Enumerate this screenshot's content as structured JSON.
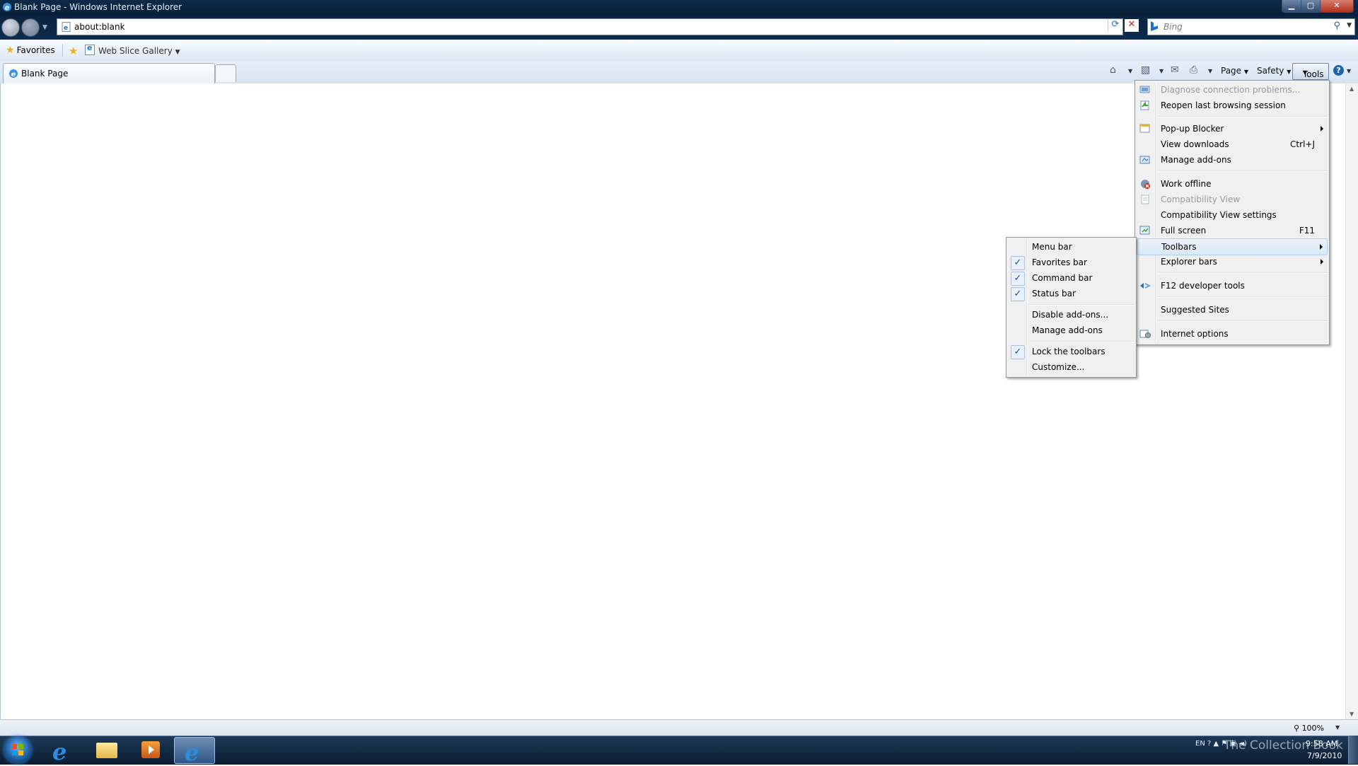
{
  "window": {
    "title": "Blank Page - Windows Internet Explorer",
    "min_label": "▁",
    "max_label": "▢",
    "close_label": "✕"
  },
  "address": {
    "url": "about:blank"
  },
  "search": {
    "placeholder": "Bing"
  },
  "favorites_bar": {
    "favorites_label": "Favorites",
    "web_slice_label": "Web Slice Gallery"
  },
  "tabs": [
    {
      "label": "Blank Page"
    }
  ],
  "command_bar": {
    "page_label": "Page",
    "safety_label": "Safety",
    "tools_label": "Tools",
    "help_label": "?"
  },
  "tools_menu": {
    "items": [
      {
        "label": "Diagnose connection problems...",
        "disabled": true
      },
      {
        "label": "Reopen last browsing session"
      },
      {
        "label": "Pop-up Blocker",
        "submenu": true
      },
      {
        "label": "View downloads",
        "shortcut": "Ctrl+J"
      },
      {
        "label": "Manage add-ons"
      },
      {
        "label": "Work offline"
      },
      {
        "label": "Compatibility View",
        "disabled": true
      },
      {
        "label": "Compatibility View settings"
      },
      {
        "label": "Full screen",
        "shortcut": "F11"
      },
      {
        "label": "Toolbars",
        "submenu": true,
        "highlighted": true
      },
      {
        "label": "Explorer bars",
        "submenu": true
      },
      {
        "label": "F12 developer tools"
      },
      {
        "label": "Suggested Sites"
      },
      {
        "label": "Internet options"
      }
    ]
  },
  "toolbars_submenu": {
    "items": [
      {
        "label": "Menu bar",
        "checked": false
      },
      {
        "label": "Favorites bar",
        "checked": true
      },
      {
        "label": "Command bar",
        "checked": true
      },
      {
        "label": "Status bar",
        "checked": true
      },
      {
        "label": "Disable add-ons...",
        "checked": false
      },
      {
        "label": "Manage add-ons",
        "checked": false
      },
      {
        "label": "Lock the toolbars",
        "checked": true
      },
      {
        "label": "Customize...",
        "checked": false
      }
    ]
  },
  "status_bar": {
    "zoom": "100%"
  },
  "taskbar": {
    "tray": "EN",
    "time": "9:58 AM",
    "date": "7/9/2010",
    "watermark": "The Collection Book"
  },
  "colors": {
    "titlebar": "#0c2a4a",
    "accent": "#1f63b8",
    "menu_bg": "#f0f0f0"
  }
}
